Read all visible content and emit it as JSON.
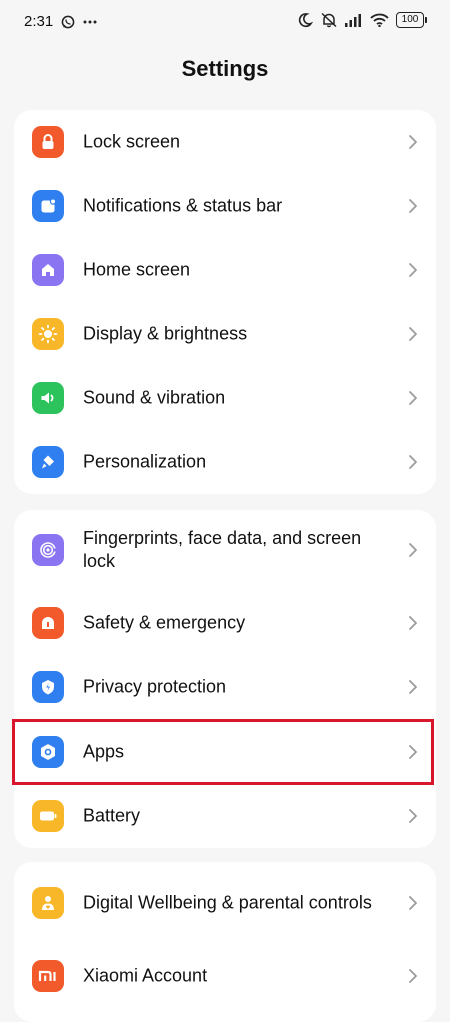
{
  "status_bar": {
    "time": "2:31",
    "battery": "100",
    "icons": [
      "whatsapp-icon",
      "more-dots-icon",
      "moon-icon",
      "silent-bell-icon",
      "signal-icon",
      "wifi-icon",
      "battery-icon"
    ]
  },
  "header": {
    "title": "Settings"
  },
  "groups": [
    {
      "items": [
        {
          "label": "Lock screen",
          "icon": "lock-icon",
          "color": "#f25a2c"
        },
        {
          "label": "Notifications & status bar",
          "icon": "notification-icon",
          "color": "#2f7ff0"
        },
        {
          "label": "Home screen",
          "icon": "home-icon",
          "color": "#8a74f2"
        },
        {
          "label": "Display & brightness",
          "icon": "sun-icon",
          "color": "#f7b728"
        },
        {
          "label": "Sound & vibration",
          "icon": "speaker-icon",
          "color": "#2dc35c"
        },
        {
          "label": "Personalization",
          "icon": "brush-icon",
          "color": "#2f7ff0"
        }
      ]
    },
    {
      "items": [
        {
          "label": "Fingerprints, face data, and screen lock",
          "icon": "fingerprint-icon",
          "color": "#8a74f2"
        },
        {
          "label": "Safety & emergency",
          "icon": "emergency-icon",
          "color": "#f25a2c"
        },
        {
          "label": "Privacy protection",
          "icon": "privacy-icon",
          "color": "#2f7ff0"
        },
        {
          "label": "Apps",
          "icon": "apps-icon",
          "color": "#2f7ff0"
        },
        {
          "label": "Battery",
          "icon": "battery-setting-icon",
          "color": "#f7b728"
        }
      ]
    },
    {
      "items": [
        {
          "label": "Digital Wellbeing & parental controls",
          "icon": "wellbeing-icon",
          "color": "#f7b728"
        },
        {
          "label": "Xiaomi Account",
          "icon": "mi-icon",
          "color": "#f25a2c"
        }
      ]
    }
  ],
  "highlight": {
    "color": "#d8172b",
    "target": "Apps"
  }
}
